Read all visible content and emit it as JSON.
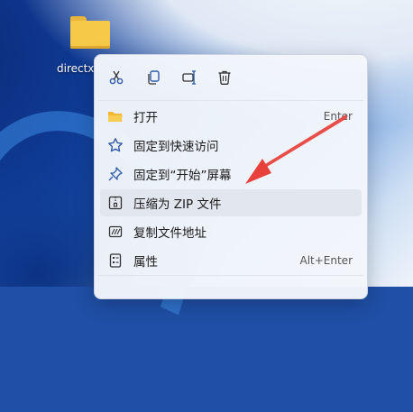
{
  "desktop": {
    "icon_label": "directx"
  },
  "toolbar": {
    "cut": "cut-icon",
    "copy": "copy-icon",
    "rename": "rename-icon",
    "delete": "delete-icon"
  },
  "menu": {
    "items": [
      {
        "label": "打开",
        "shortcut": "Enter",
        "icon": "folder-open-icon"
      },
      {
        "label": "固定到快速访问",
        "shortcut": "",
        "icon": "star-icon"
      },
      {
        "label": "固定到“开始”屏幕",
        "shortcut": "",
        "icon": "pin-icon"
      },
      {
        "label": "压缩为 ZIP 文件",
        "shortcut": "",
        "icon": "zip-icon"
      },
      {
        "label": "复制文件地址",
        "shortcut": "",
        "icon": "copy-path-icon"
      },
      {
        "label": "属性",
        "shortcut": "Alt+Enter",
        "icon": "properties-icon"
      }
    ]
  },
  "annotation": {
    "arrow_color": "#e8403a"
  }
}
